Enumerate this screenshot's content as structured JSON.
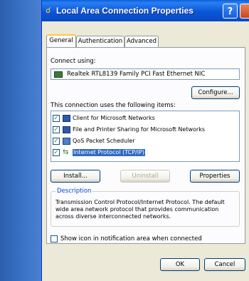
{
  "window": {
    "title": "Local Area Connection Properties",
    "help_label": "?"
  },
  "tabs": [
    {
      "label": "General",
      "active": true
    },
    {
      "label": "Authentication",
      "active": false
    },
    {
      "label": "Advanced",
      "active": false
    }
  ],
  "connect_using": {
    "label": "Connect using:",
    "adapter": "Realtek RTL8139 Family PCI Fast Ethernet NIC",
    "configure_label": "Configure..."
  },
  "items_section": {
    "label": "This connection uses the following items:",
    "items": [
      {
        "label": "Client for Microsoft Networks",
        "checked": true,
        "selected": false,
        "icon": "network-client-icon"
      },
      {
        "label": "File and Printer Sharing for Microsoft Networks",
        "checked": true,
        "selected": false,
        "icon": "file-printer-sharing-icon"
      },
      {
        "label": "QoS Packet Scheduler",
        "checked": true,
        "selected": false,
        "icon": "qos-scheduler-icon"
      },
      {
        "label": "Internet Protocol (TCP/IP)",
        "checked": true,
        "selected": true,
        "icon": "protocol-icon"
      }
    ]
  },
  "buttons": {
    "install": "Install...",
    "uninstall": "Uninstall",
    "properties": "Properties",
    "ok": "OK",
    "cancel": "Cancel"
  },
  "description": {
    "legend": "Description",
    "text": "Transmission Control Protocol/Internet Protocol. The default wide area network protocol that provides communication across diverse interconnected networks."
  },
  "notification": {
    "label": "Show icon in notification area when connected",
    "checked": false
  },
  "colors": {
    "titlebar": "#0a56d8",
    "dialog_bg": "#ece9d8",
    "selection": "#316ac5",
    "desktop": "#3a6ea5"
  }
}
